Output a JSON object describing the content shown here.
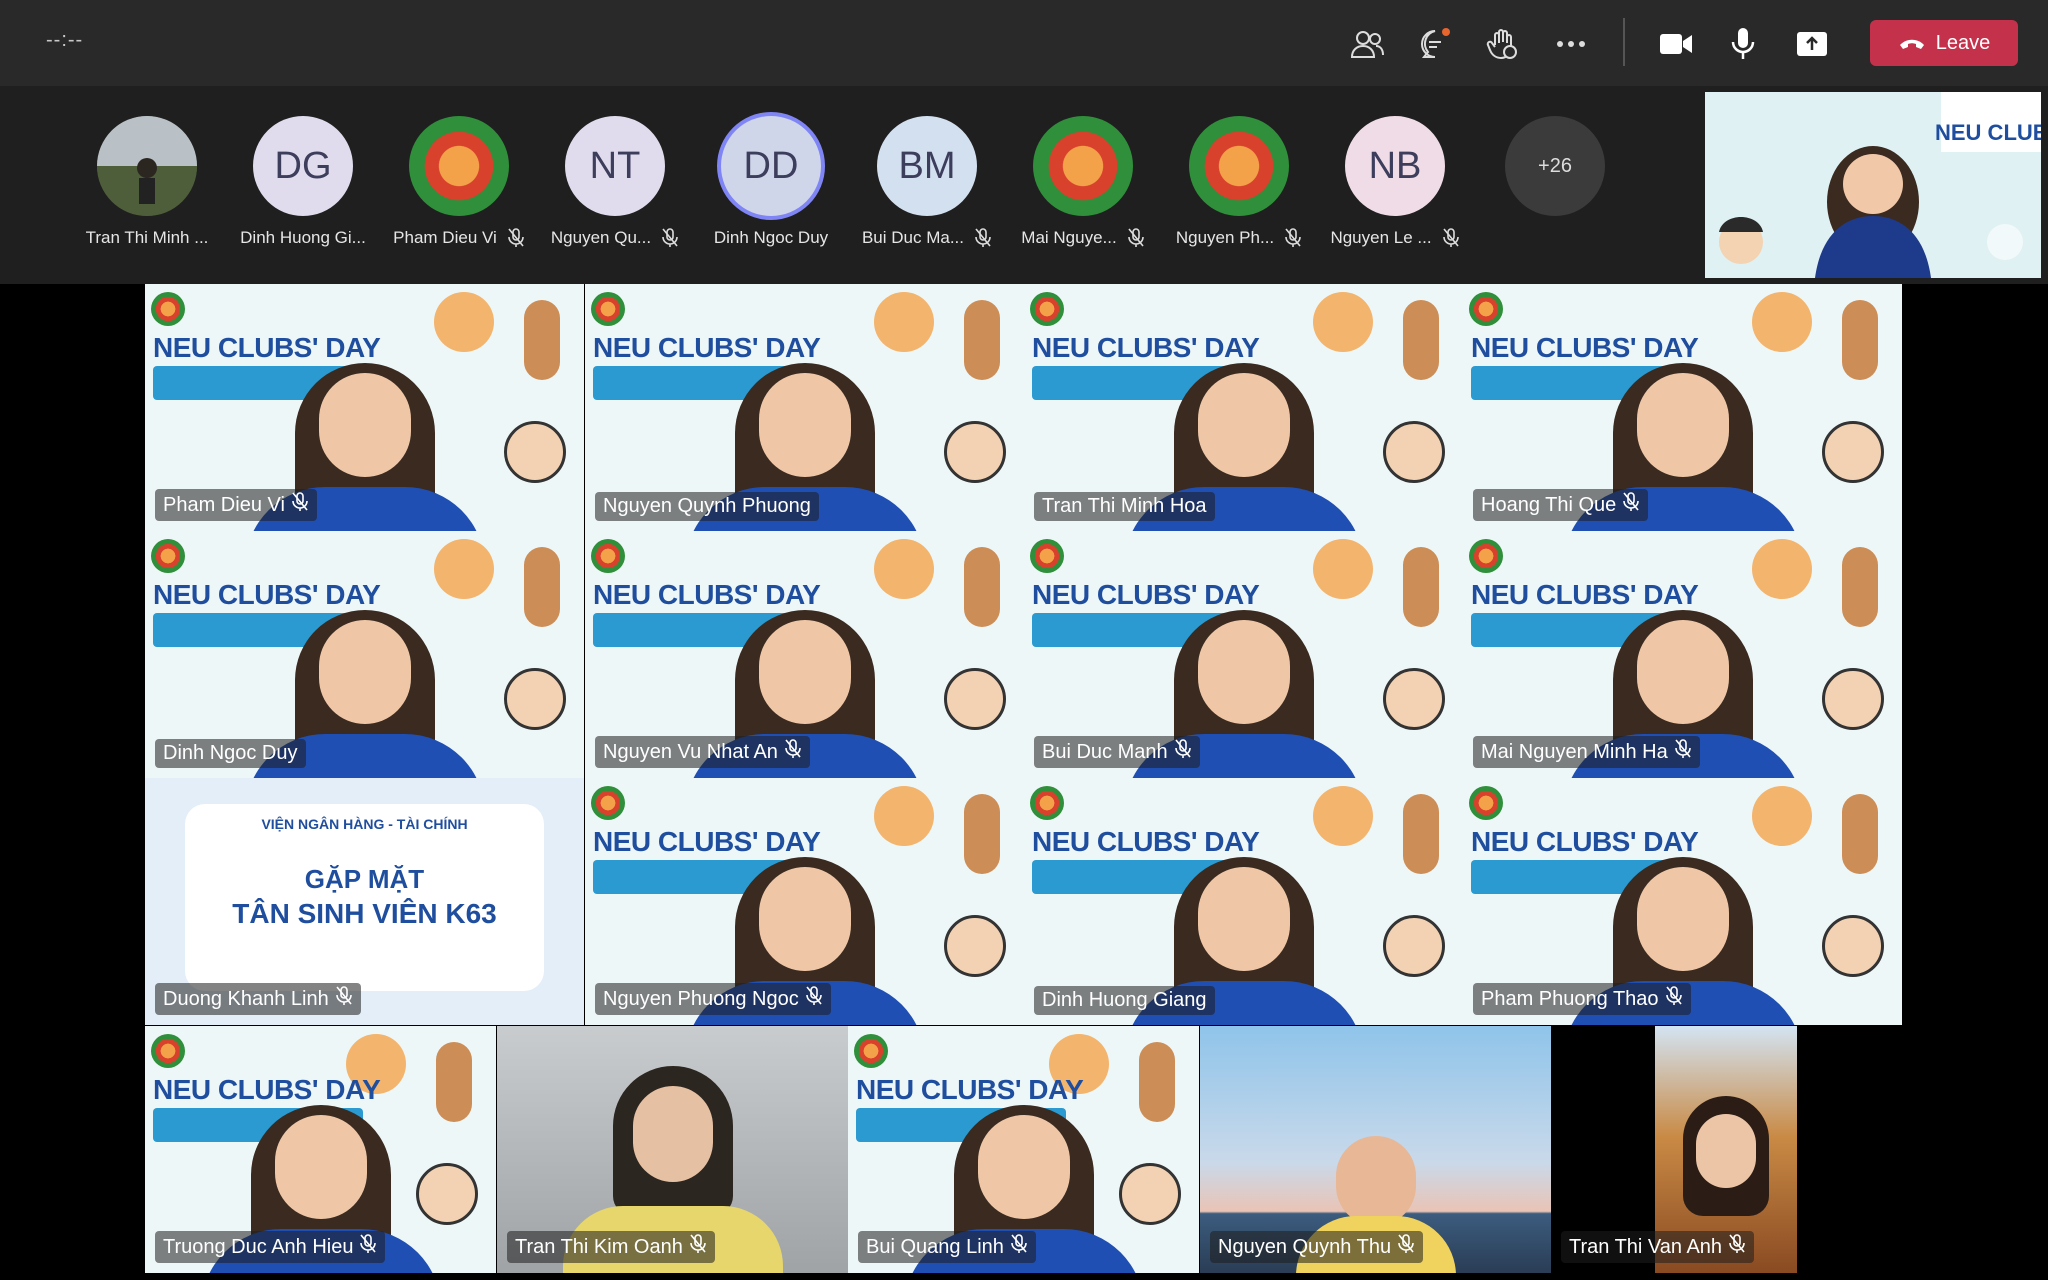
{
  "meeting": {
    "timer": "--:--"
  },
  "toolbar": {
    "people_icon": "people-icon",
    "chat_icon": "chat-icon",
    "reactions_icon": "raise-hand-icon",
    "more_icon": "more-options-icon",
    "camera_icon": "camera-icon",
    "mic_icon": "microphone-icon",
    "share_icon": "share-screen-icon",
    "leave_label": "Leave",
    "leave_color": "#c4314b"
  },
  "participants_strip": [
    {
      "initials": "",
      "name": "Tran Thi Minh ...",
      "muted": false,
      "avatar": "photo"
    },
    {
      "initials": "DG",
      "name": "Dinh Huong Gi...",
      "muted": false,
      "avatar": "initials"
    },
    {
      "initials": "",
      "name": "Pham Dieu Vi",
      "muted": true,
      "avatar": "logo"
    },
    {
      "initials": "NT",
      "name": "Nguyen Qu...",
      "muted": true,
      "avatar": "initials"
    },
    {
      "initials": "DD",
      "name": "Dinh Ngoc Duy",
      "muted": false,
      "avatar": "initials",
      "speaking": true
    },
    {
      "initials": "BM",
      "name": "Bui Duc Ma...",
      "muted": true,
      "avatar": "initials"
    },
    {
      "initials": "",
      "name": "Mai Nguye...",
      "muted": true,
      "avatar": "logo"
    },
    {
      "initials": "",
      "name": "Nguyen Ph...",
      "muted": true,
      "avatar": "logo"
    },
    {
      "initials": "NB",
      "name": "Nguyen Le ...",
      "muted": true,
      "avatar": "initials"
    }
  ],
  "overflow_count": "+26",
  "grid": [
    {
      "name": "Pham Dieu Vi",
      "muted": true,
      "bg": "banner"
    },
    {
      "name": "Nguyen Quynh Phuong",
      "muted": false,
      "bg": "banner"
    },
    {
      "name": "Tran Thi Minh Hoa",
      "muted": false,
      "bg": "banner"
    },
    {
      "name": "Hoang Thi Que",
      "muted": true,
      "bg": "banner"
    },
    {
      "name": "Dinh Ngoc Duy",
      "muted": false,
      "bg": "banner"
    },
    {
      "name": "Nguyen Vu Nhat An",
      "muted": true,
      "bg": "banner"
    },
    {
      "name": "Bui Duc Manh",
      "muted": true,
      "bg": "banner"
    },
    {
      "name": "Mai Nguyen Minh Ha",
      "muted": true,
      "bg": "banner"
    },
    {
      "name": "Duong Khanh Linh",
      "muted": true,
      "bg": "slide"
    },
    {
      "name": "Nguyen Phuong  Ngoc",
      "muted": true,
      "bg": "banner"
    },
    {
      "name": "Dinh Huong Giang",
      "muted": false,
      "bg": "banner"
    },
    {
      "name": "Pham Phuong Thao",
      "muted": true,
      "bg": "banner"
    },
    {
      "name": "Truong Duc Anh Hieu",
      "muted": true,
      "bg": "banner"
    },
    {
      "name": "Tran Thi Kim Oanh",
      "muted": true,
      "bg": "room"
    },
    {
      "name": "Bui Quang Linh",
      "muted": true,
      "bg": "banner"
    },
    {
      "name": "Nguyen Quynh Thu",
      "muted": true,
      "bg": "beach"
    },
    {
      "name": "Tran Thi Van Anh",
      "muted": true,
      "bg": "autumn"
    }
  ],
  "background_text": {
    "banner_title": "NEU CLUBS' DAY",
    "slide_header": "VIỆN NGÂN HÀNG - TÀI CHÍNH",
    "slide_title_1": "GẶP MẶT",
    "slide_title_2": "TÂN SINH VIÊN K63"
  }
}
